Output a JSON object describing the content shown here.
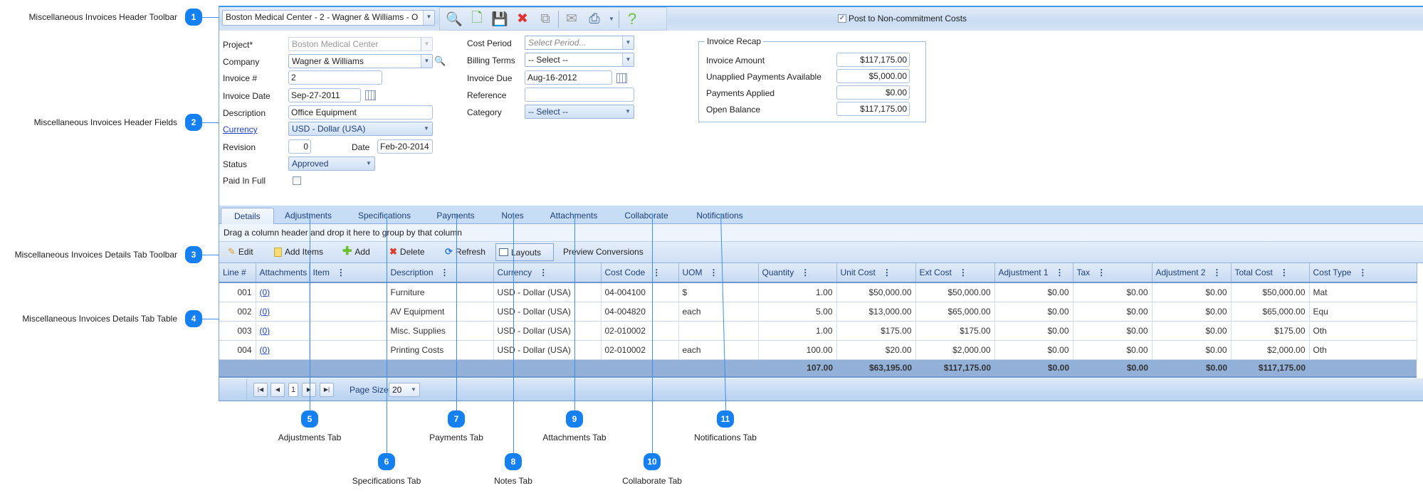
{
  "colors": {
    "accent": "#1580f2",
    "tabbar": "#c7dcf5",
    "footer": "#93b0d8"
  },
  "callouts": [
    {
      "num": "1",
      "label": "Miscellaneous Invoices Header Toolbar"
    },
    {
      "num": "2",
      "label": "Miscellaneous Invoices Header Fields"
    },
    {
      "num": "3",
      "label": "Miscellaneous Invoices Details Tab Toolbar"
    },
    {
      "num": "4",
      "label": "Miscellaneous Invoices Details Tab Table"
    },
    {
      "num": "5",
      "label": "Adjustments Tab"
    },
    {
      "num": "6",
      "label": "Specifications Tab"
    },
    {
      "num": "7",
      "label": "Payments Tab"
    },
    {
      "num": "8",
      "label": "Notes Tab"
    },
    {
      "num": "9",
      "label": "Attachments Tab"
    },
    {
      "num": "10",
      "label": "Collaborate Tab"
    },
    {
      "num": "11",
      "label": "Notifications Tab"
    }
  ],
  "toolbar": {
    "record_selector": "Boston Medical Center - 2 - Wagner & Williams - O",
    "icons": [
      "search-icon",
      "new-icon",
      "save-icon",
      "delete-icon",
      "copy-icon",
      "email-icon",
      "print-icon",
      "dropdown-icon",
      "help-icon"
    ],
    "post_non_commitment": {
      "label": "Post to Non-commitment Costs",
      "checked": true
    }
  },
  "header": {
    "project": {
      "label": "Project*",
      "value": "Boston Medical Center"
    },
    "company": {
      "label": "Company",
      "value": "Wagner & Williams"
    },
    "invoice_num": {
      "label": "Invoice #",
      "value": "2"
    },
    "invoice_date": {
      "label": "Invoice Date",
      "value": "Sep-27-2011"
    },
    "description": {
      "label": "Description",
      "value": "Office Equipment"
    },
    "currency": {
      "label": "Currency",
      "value": "USD - Dollar (USA)"
    },
    "revision": {
      "label": "Revision",
      "value": "0"
    },
    "date": {
      "label": "Date",
      "value": "Feb-20-2014"
    },
    "status": {
      "label": "Status",
      "value": "Approved"
    },
    "paid_in_full": {
      "label": "Paid In Full",
      "checked": false
    },
    "cost_period": {
      "label": "Cost Period",
      "placeholder": "Select Period..."
    },
    "billing_terms": {
      "label": "Billing Terms",
      "value": "-- Select --"
    },
    "invoice_due": {
      "label": "Invoice Due",
      "value": "Aug-16-2012"
    },
    "reference": {
      "label": "Reference",
      "value": ""
    },
    "category": {
      "label": "Category",
      "value": "-- Select --"
    }
  },
  "recap": {
    "title": "Invoice Recap",
    "rows": [
      {
        "label": "Invoice Amount",
        "value": "$117,175.00"
      },
      {
        "label": "Unapplied Payments Available",
        "value": "$5,000.00"
      },
      {
        "label": "Payments Applied",
        "value": "$0.00"
      },
      {
        "label": "Open Balance",
        "value": "$117,175.00"
      }
    ]
  },
  "tabs": [
    "Details",
    "Adjustments",
    "Specifications",
    "Payments",
    "Notes",
    "Attachments",
    "Collaborate",
    "Notifications"
  ],
  "active_tab": "Details",
  "grid": {
    "group_hint": "Drag a column header and drop it here to group by that column",
    "toolbar": {
      "edit": "Edit",
      "add_items": "Add Items",
      "add": "Add",
      "delete": "Delete",
      "refresh": "Refresh",
      "layouts": "Layouts",
      "preview": "Preview Conversions"
    },
    "columns": [
      "Line #",
      "Attachments",
      "Item",
      "Description",
      "Currency",
      "Cost Code",
      "UOM",
      "Quantity",
      "Unit Cost",
      "Ext Cost",
      "Adjustment 1",
      "Tax",
      "Adjustment 2",
      "Total Cost",
      "Cost Type"
    ],
    "rows": [
      [
        "001",
        "(0)",
        "",
        "Furniture",
        "USD - Dollar (USA)",
        "04-004100",
        "$",
        "1.00",
        "$50,000.00",
        "$50,000.00",
        "$0.00",
        "$0.00",
        "$0.00",
        "$50,000.00",
        "Mat"
      ],
      [
        "002",
        "(0)",
        "",
        "AV Equipment",
        "USD - Dollar (USA)",
        "04-004820",
        "each",
        "5.00",
        "$13,000.00",
        "$65,000.00",
        "$0.00",
        "$0.00",
        "$0.00",
        "$65,000.00",
        "Equ"
      ],
      [
        "003",
        "(0)",
        "",
        "Misc. Supplies",
        "USD - Dollar (USA)",
        "02-010002",
        "",
        "1.00",
        "$175.00",
        "$175.00",
        "$0.00",
        "$0.00",
        "$0.00",
        "$175.00",
        "Oth"
      ],
      [
        "004",
        "(0)",
        "",
        "Printing Costs",
        "USD - Dollar (USA)",
        "02-010002",
        "each",
        "100.00",
        "$20.00",
        "$2,000.00",
        "$0.00",
        "$0.00",
        "$0.00",
        "$2,000.00",
        "Oth"
      ]
    ],
    "totals": [
      "",
      "",
      "",
      "",
      "",
      "",
      "",
      "107.00",
      "$63,195.00",
      "$117,175.00",
      "$0.00",
      "$0.00",
      "$0.00",
      "$117,175.00",
      ""
    ],
    "pager": {
      "current_page": "1",
      "page_size_label": "Page Size",
      "page_size": "20"
    }
  }
}
